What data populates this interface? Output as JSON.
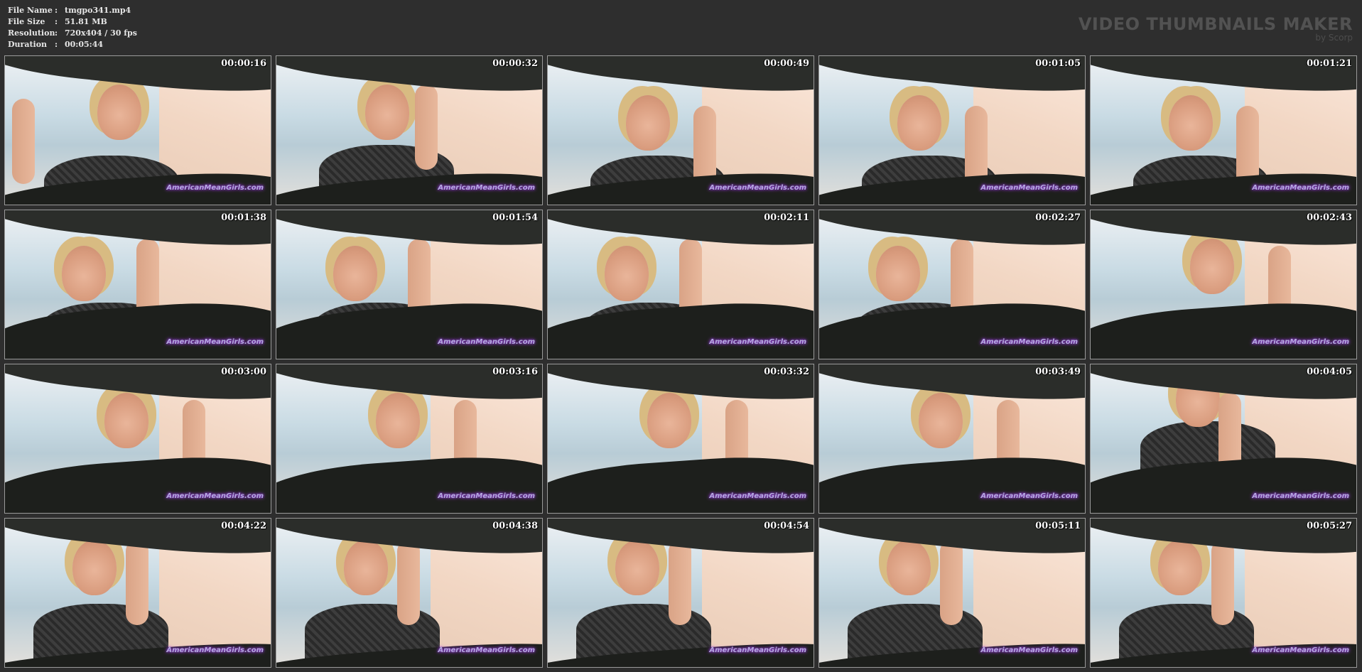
{
  "file_info": {
    "rows": [
      {
        "key": "File Name",
        "sep": ":",
        "value": "tmgpo341.mp4"
      },
      {
        "key": "File Size",
        "sep": ":",
        "value": "51.81 MB"
      },
      {
        "key": "Resolution",
        "sep": ":",
        "value": "720x404 / 30 fps"
      },
      {
        "key": "Duration",
        "sep": ":",
        "value": "00:05:44"
      }
    ]
  },
  "brand": {
    "title": "VIDEO THUMBNAILS MAKER",
    "subtitle": "by Scorp"
  },
  "watermark_text": "AmericanMeanGirls.com",
  "thumbnails": [
    {
      "time": "00:00:16",
      "pose": "a"
    },
    {
      "time": "00:00:32",
      "pose": "b"
    },
    {
      "time": "00:00:49",
      "pose": "c"
    },
    {
      "time": "00:01:05",
      "pose": "c"
    },
    {
      "time": "00:01:21",
      "pose": "c"
    },
    {
      "time": "00:01:38",
      "pose": "d"
    },
    {
      "time": "00:01:54",
      "pose": "d"
    },
    {
      "time": "00:02:11",
      "pose": "d"
    },
    {
      "time": "00:02:27",
      "pose": "d"
    },
    {
      "time": "00:02:43",
      "pose": "e"
    },
    {
      "time": "00:03:00",
      "pose": "e"
    },
    {
      "time": "00:03:16",
      "pose": "e"
    },
    {
      "time": "00:03:32",
      "pose": "e"
    },
    {
      "time": "00:03:49",
      "pose": "e"
    },
    {
      "time": "00:04:05",
      "pose": "f"
    },
    {
      "time": "00:04:22",
      "pose": "g"
    },
    {
      "time": "00:04:38",
      "pose": "g"
    },
    {
      "time": "00:04:54",
      "pose": "g"
    },
    {
      "time": "00:05:11",
      "pose": "g"
    },
    {
      "time": "00:05:27",
      "pose": "g"
    }
  ]
}
